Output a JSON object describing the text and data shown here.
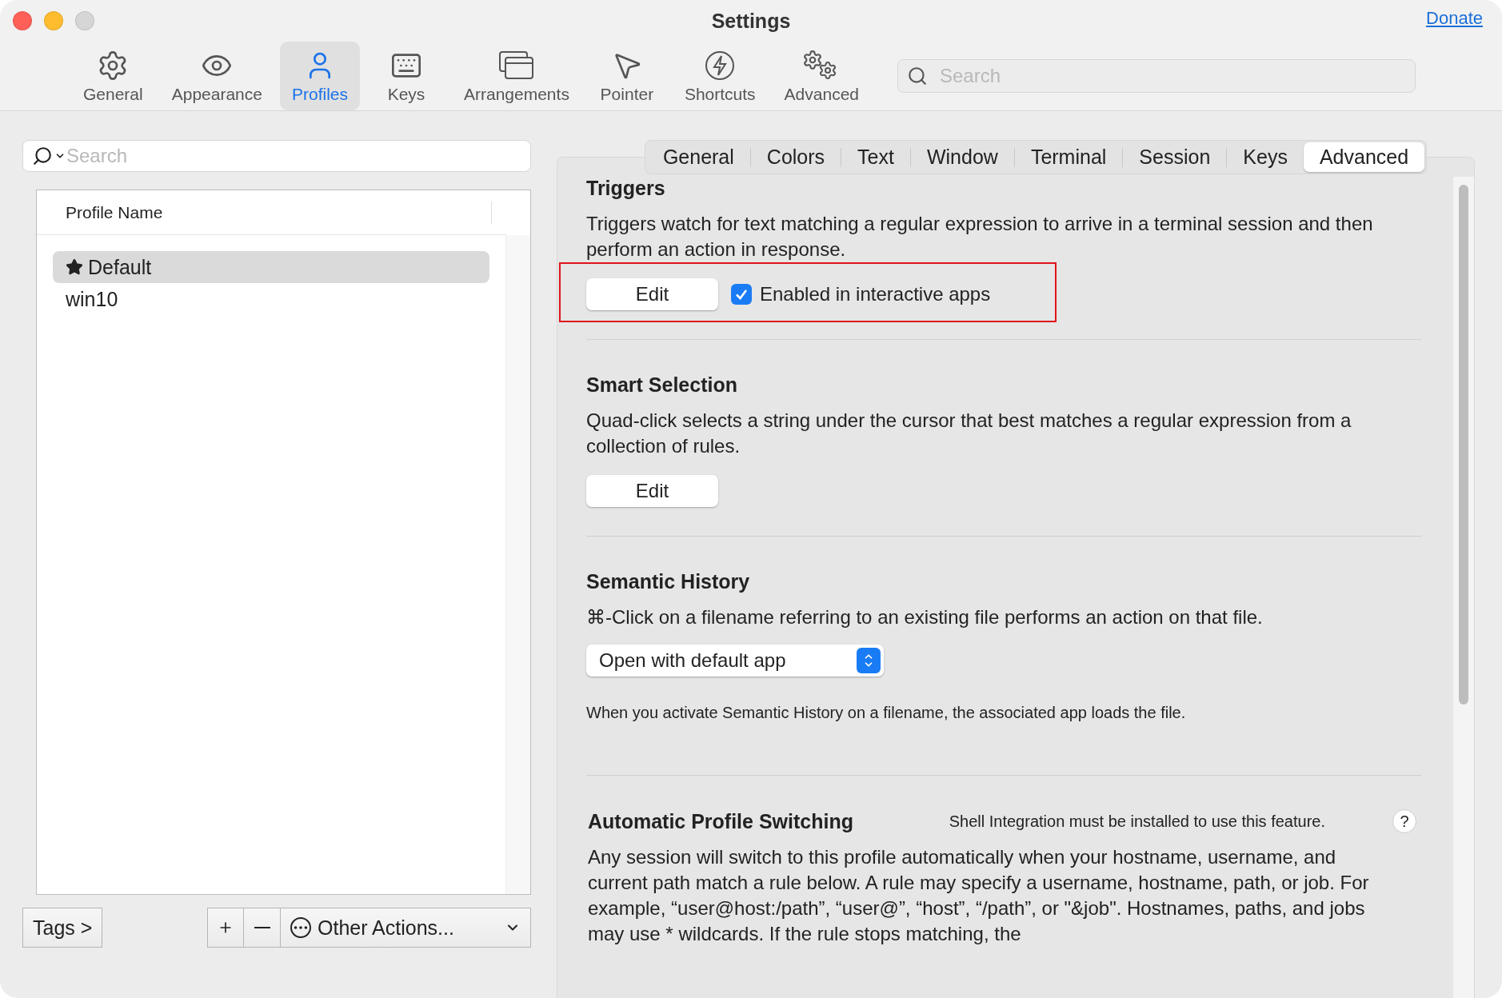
{
  "window": {
    "title": "Settings"
  },
  "donate_link": "Donate",
  "toolbar": {
    "items": [
      {
        "label": "General",
        "kind": "gear",
        "selected": false
      },
      {
        "label": "Appearance",
        "kind": "eye",
        "selected": false
      },
      {
        "label": "Profiles",
        "kind": "person",
        "selected": true
      },
      {
        "label": "Keys",
        "kind": "keyboard",
        "selected": false
      },
      {
        "label": "Arrangements",
        "kind": "windows",
        "selected": false
      },
      {
        "label": "Pointer",
        "kind": "pointer",
        "selected": false
      },
      {
        "label": "Shortcuts",
        "kind": "bolt",
        "selected": false
      },
      {
        "label": "Advanced",
        "kind": "gears",
        "selected": false
      }
    ],
    "search": {
      "placeholder": "Search"
    }
  },
  "profiles": {
    "search": {
      "placeholder": "Search"
    },
    "column": "Profile Name",
    "rows": [
      {
        "name": "Default",
        "default": true,
        "selected": true
      },
      {
        "name": "win10",
        "default": false,
        "selected": false
      }
    ],
    "tags_button": "Tags >",
    "other_actions": "Other Actions..."
  },
  "profile_tabs": [
    {
      "label": "General",
      "selected": false
    },
    {
      "label": "Colors",
      "selected": false
    },
    {
      "label": "Text",
      "selected": false
    },
    {
      "label": "Window",
      "selected": false
    },
    {
      "label": "Terminal",
      "selected": false
    },
    {
      "label": "Session",
      "selected": false
    },
    {
      "label": "Keys",
      "selected": false
    },
    {
      "label": "Advanced",
      "selected": true
    }
  ],
  "sections": [
    {
      "kind": "triggers",
      "title": "Triggers",
      "description": "Triggers watch for text matching a regular expression to arrive in a terminal session and then perform an action in response.",
      "button": "Edit",
      "checkbox": {
        "label": "Enabled in interactive apps",
        "checked": true
      },
      "highlighted": true
    },
    {
      "kind": "smart_selection",
      "title": "Smart Selection",
      "description": "Quad-click selects a string under the cursor that best matches a regular expression from a collection of rules.",
      "button": "Edit"
    },
    {
      "kind": "semantic_history",
      "title": "Semantic History",
      "description": "⌘-Click on a filename referring to an existing file performs an action on that file.",
      "select": {
        "value": "Open with default app"
      },
      "note": "When you activate Semantic History on a filename, the associated app loads the file."
    },
    {
      "kind": "profile_switching",
      "title": "Automatic Profile Switching",
      "note": "Shell Integration must be installed to use this feature.",
      "help": "?",
      "description": "Any session will switch to this profile automatically when your hostname, username, and current path match a rule below. A rule may specify a username, hostname, path, or job. For example, “user@host:/path”, “user@”, “host”, “/path”, or \"&job\". Hostnames, paths, and jobs may use * wildcards. If the rule stops matching, the"
    }
  ]
}
